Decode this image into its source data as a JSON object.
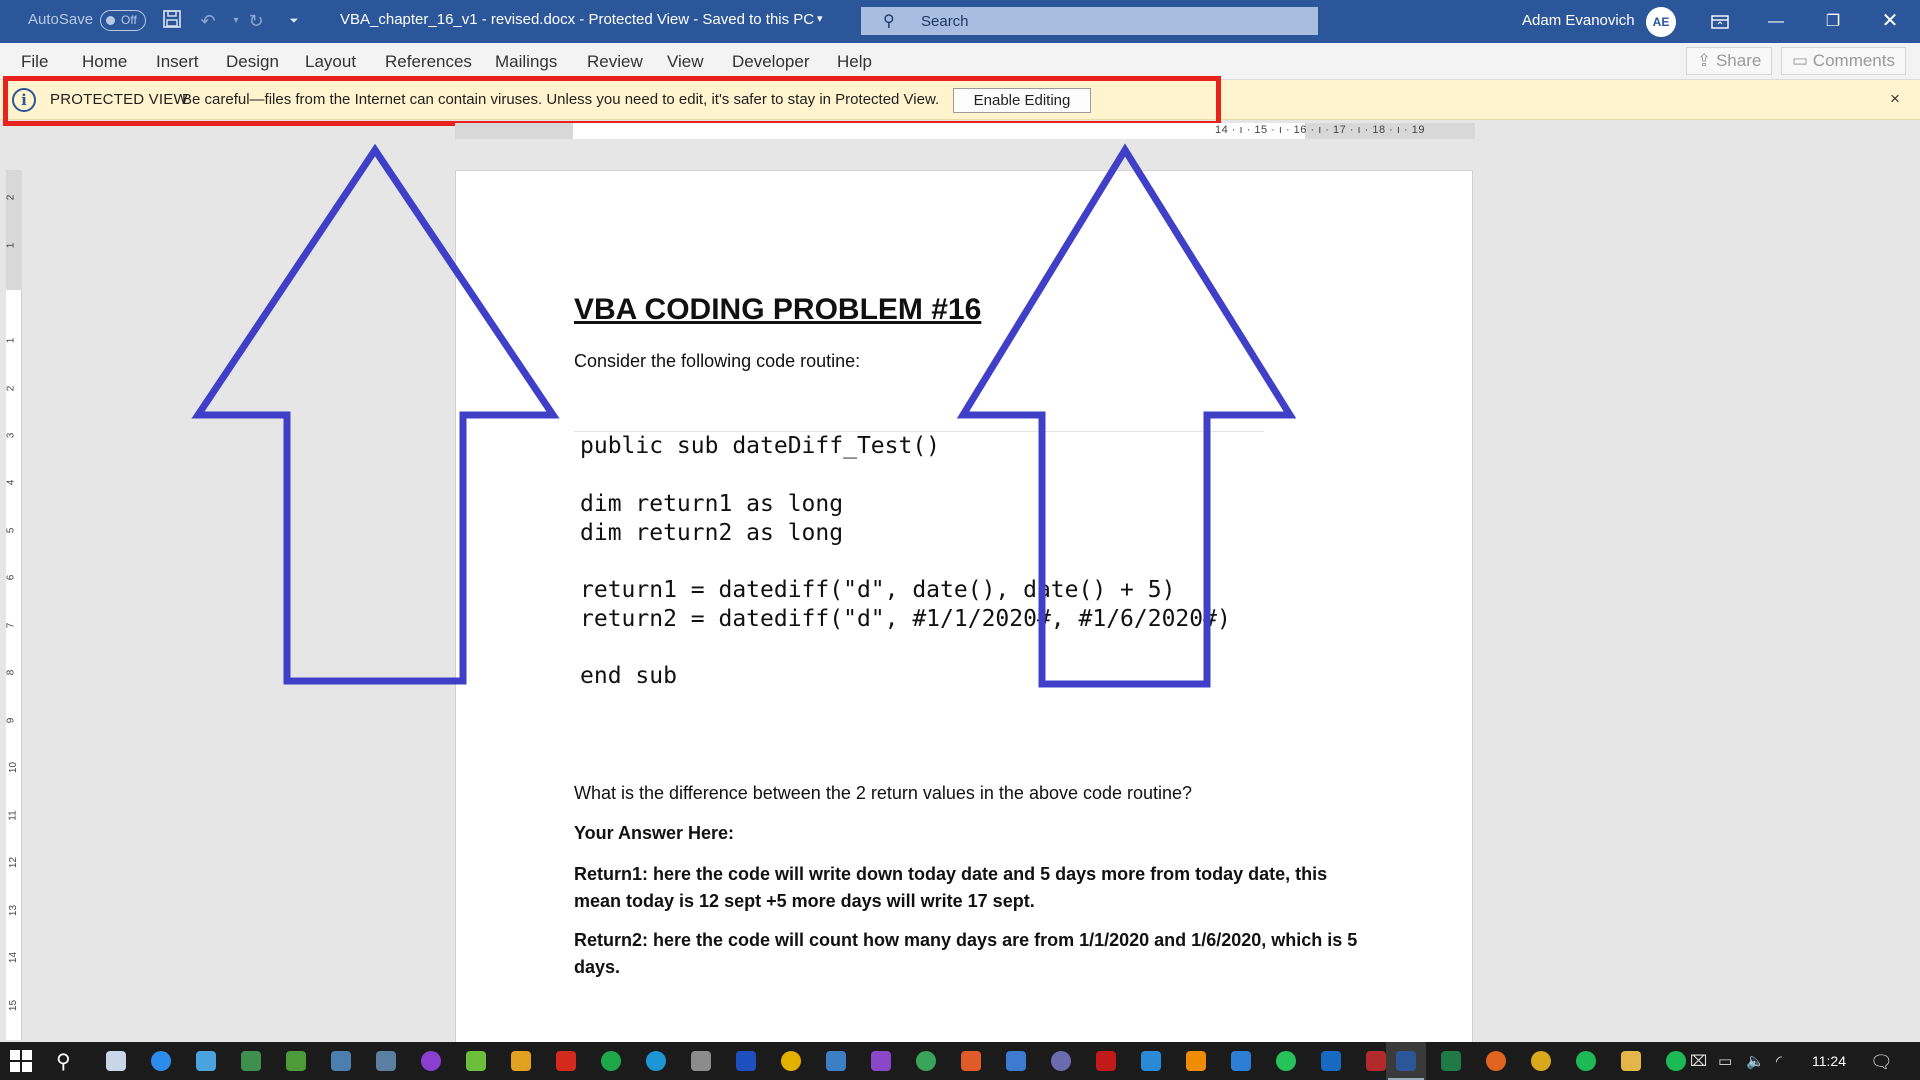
{
  "titlebar": {
    "autosave_label": "AutoSave",
    "autosave_state": "Off",
    "document_title": "VBA_chapter_16_v1 - revised.docx  -  Protected View  -  Saved to this PC",
    "search_placeholder": "Search",
    "user_name": "Adam Evanovich",
    "user_initials": "AE"
  },
  "ribbon": {
    "tabs": [
      "File",
      "Home",
      "Insert",
      "Design",
      "Layout",
      "References",
      "Mailings",
      "Review",
      "View",
      "Developer",
      "Help"
    ],
    "share_label": "Share",
    "comments_label": "Comments"
  },
  "protected_view": {
    "title": "PROTECTED VIEW",
    "message": "Be careful—files from the Internet can contain viruses. Unless you need to edit, it's safer to stay in Protected View.",
    "enable_label": "Enable Editing",
    "close_glyph": "×"
  },
  "ruler": {
    "h_labels": "14 · ı · 15 · ı · 16 · ı · 17 · ı · 18 · ı · 19",
    "v_labels": [
      "2",
      "1",
      "1",
      "2",
      "3",
      "4",
      "5",
      "6",
      "7",
      "8",
      "9",
      "10",
      "11",
      "12",
      "13",
      "14",
      "15"
    ]
  },
  "document": {
    "heading": "VBA CODING PROBLEM #16",
    "intro": "Consider the following code routine:",
    "code_lines": [
      "public sub dateDiff_Test()",
      "dim return1 as long",
      "dim return2 as long",
      "return1 = datediff(\"d\", date(), date() + 5)",
      "return2 = datediff(\"d\", #1/1/2020#, #1/6/2020#)",
      "end sub"
    ],
    "question": "What is the difference between the 2 return values in the above code routine?",
    "answer_label": "Your Answer Here:",
    "answer1": "Return1: here the code will write down today date and 5 days more from today date, this mean today is 12 sept +5 more days will write 17 sept.",
    "answer2": "Return2: here the code will count how many days are from 1/1/2020 and 1/6/2020, which is 5 days."
  },
  "taskbar": {
    "time": "11:24"
  },
  "colors": {
    "titlebar": "#2b579a",
    "highlight": "#e8221d",
    "arrow": "#3f3fc8",
    "pv_bar": "#fff4ce"
  }
}
